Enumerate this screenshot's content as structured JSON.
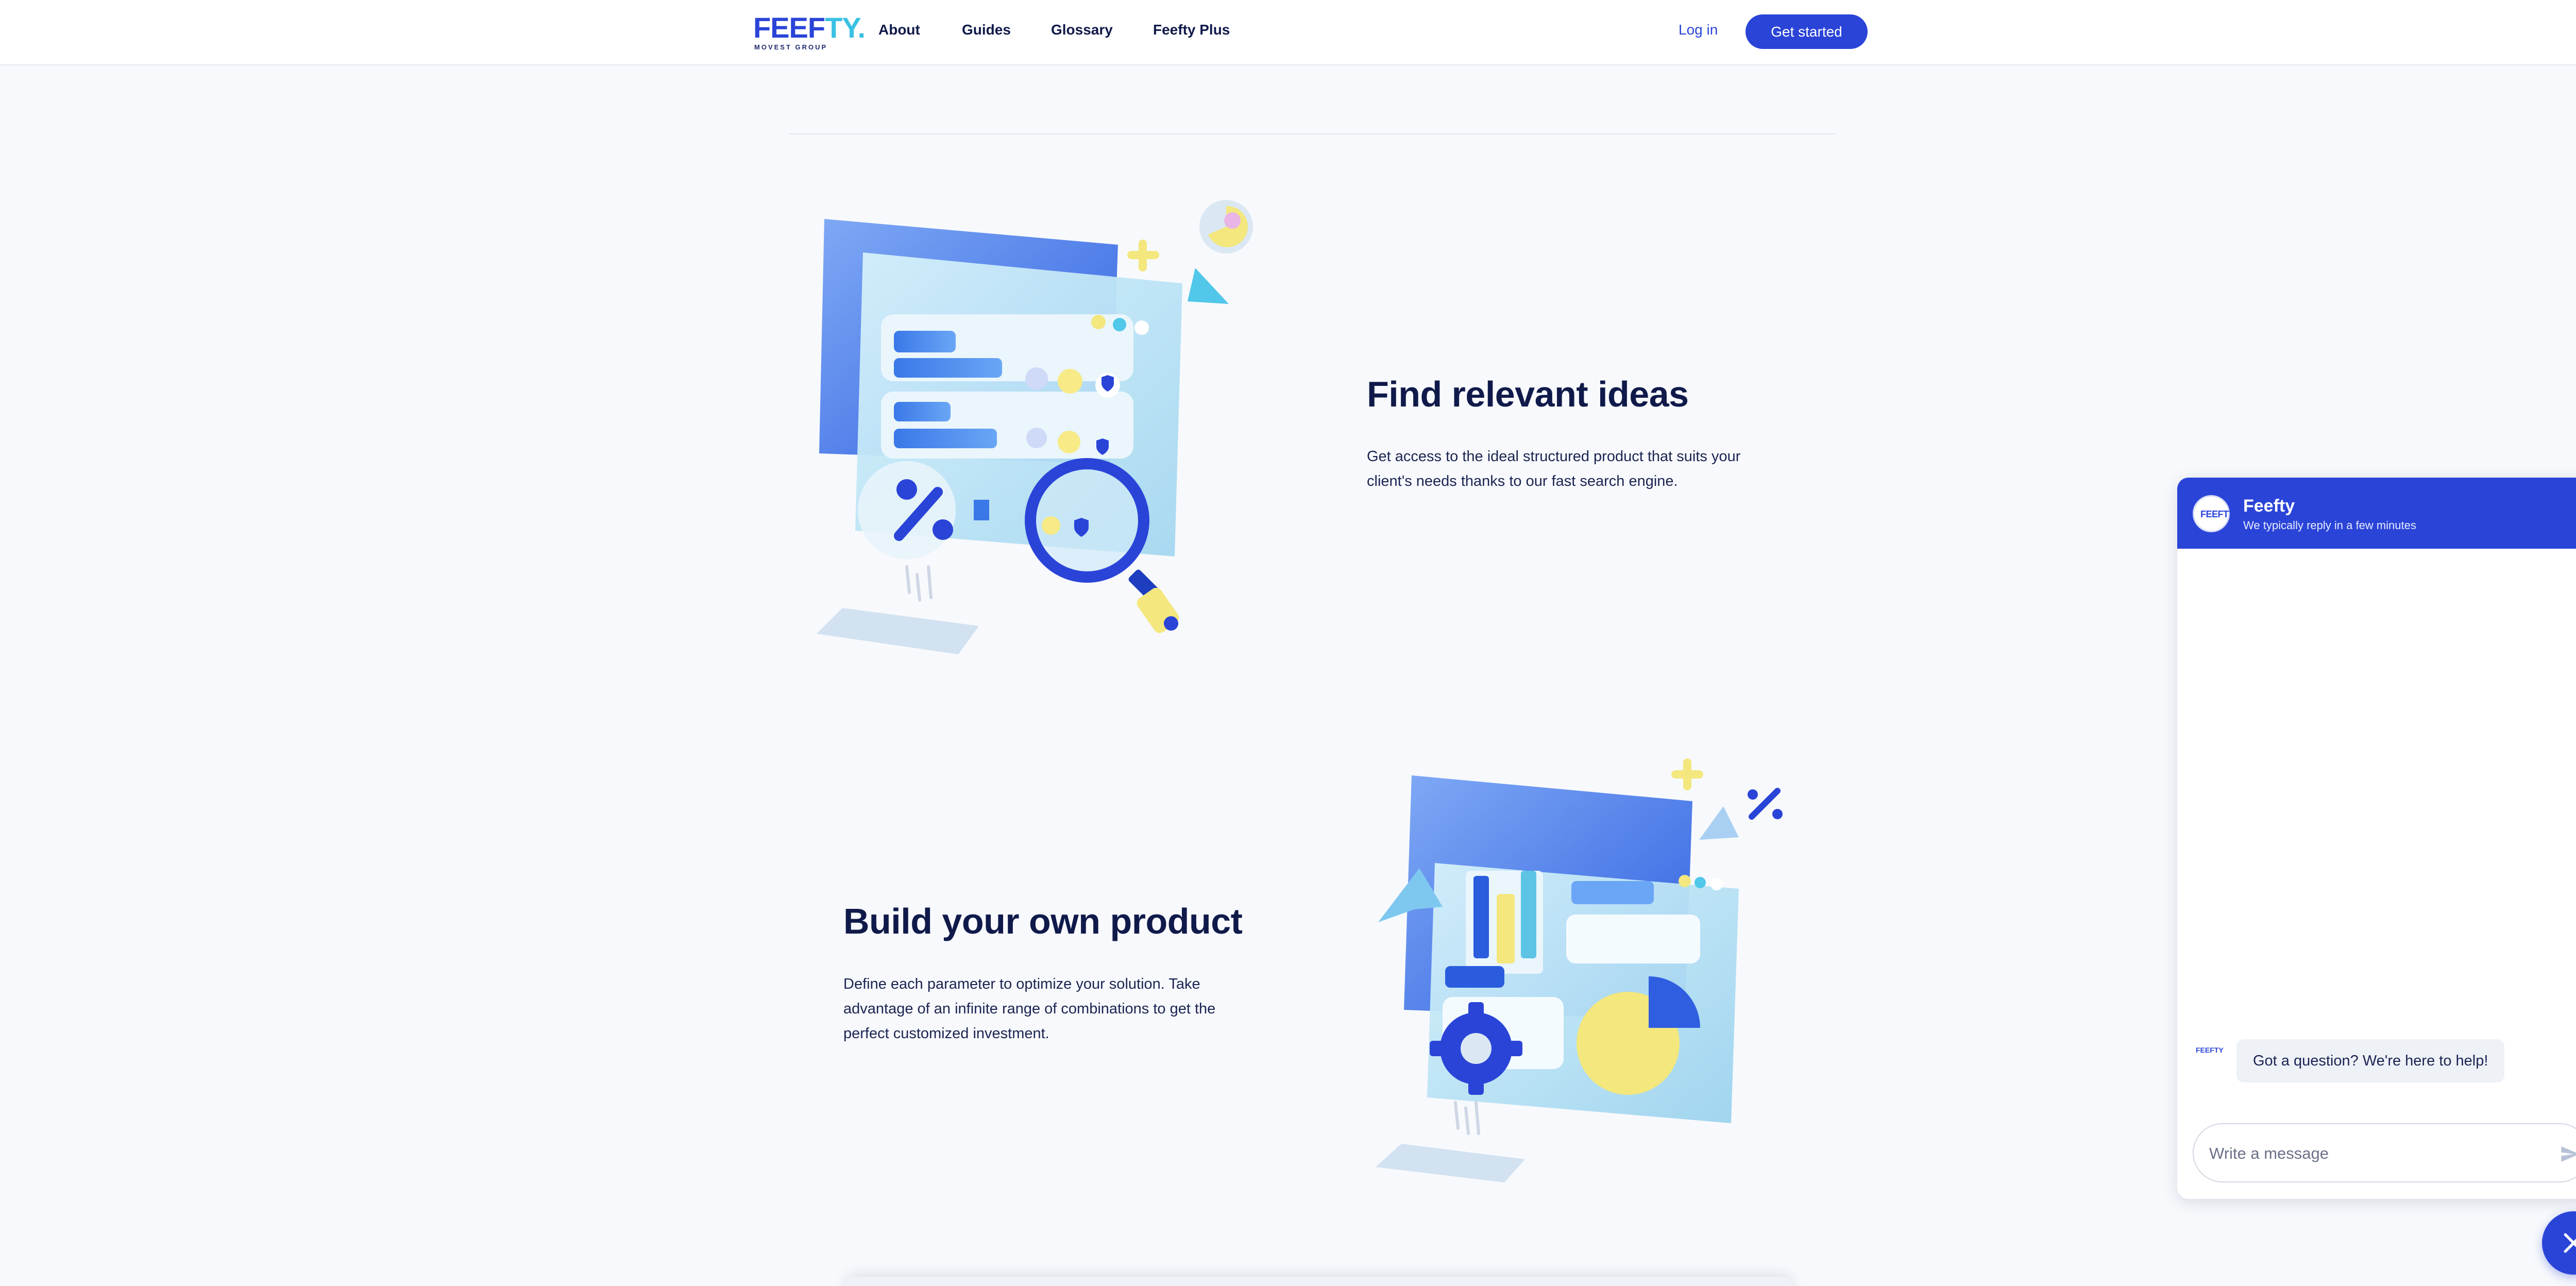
{
  "brand": {
    "logo_main": "FEEF",
    "logo_accent": "TY.",
    "logo_sub": "MOVEST GROUP",
    "primary_color": "#2a44d8",
    "accent_color": "#39c1e4"
  },
  "nav": {
    "links": [
      "About",
      "Guides",
      "Glossary",
      "Feefty Plus"
    ],
    "login": "Log in",
    "cta": "Get started"
  },
  "sections": [
    {
      "title": "Find relevant ideas",
      "text": "Get access to the ideal structured product that suits your client's needs thanks to our fast search engine."
    },
    {
      "title": "Build your own product",
      "text": "Define each parameter to optimize your solution. Take advantage of an infinite range of combinations to get the perfect customized investment."
    }
  ],
  "chat": {
    "avatar_text": "FEEFTY",
    "name": "Feefty",
    "status": "We typically reply in a few minutes",
    "messages": [
      "Got a question? We're here to help!"
    ],
    "input_placeholder": "Write a message",
    "send_icon": "send-icon",
    "toggle_icon": "close-icon"
  }
}
